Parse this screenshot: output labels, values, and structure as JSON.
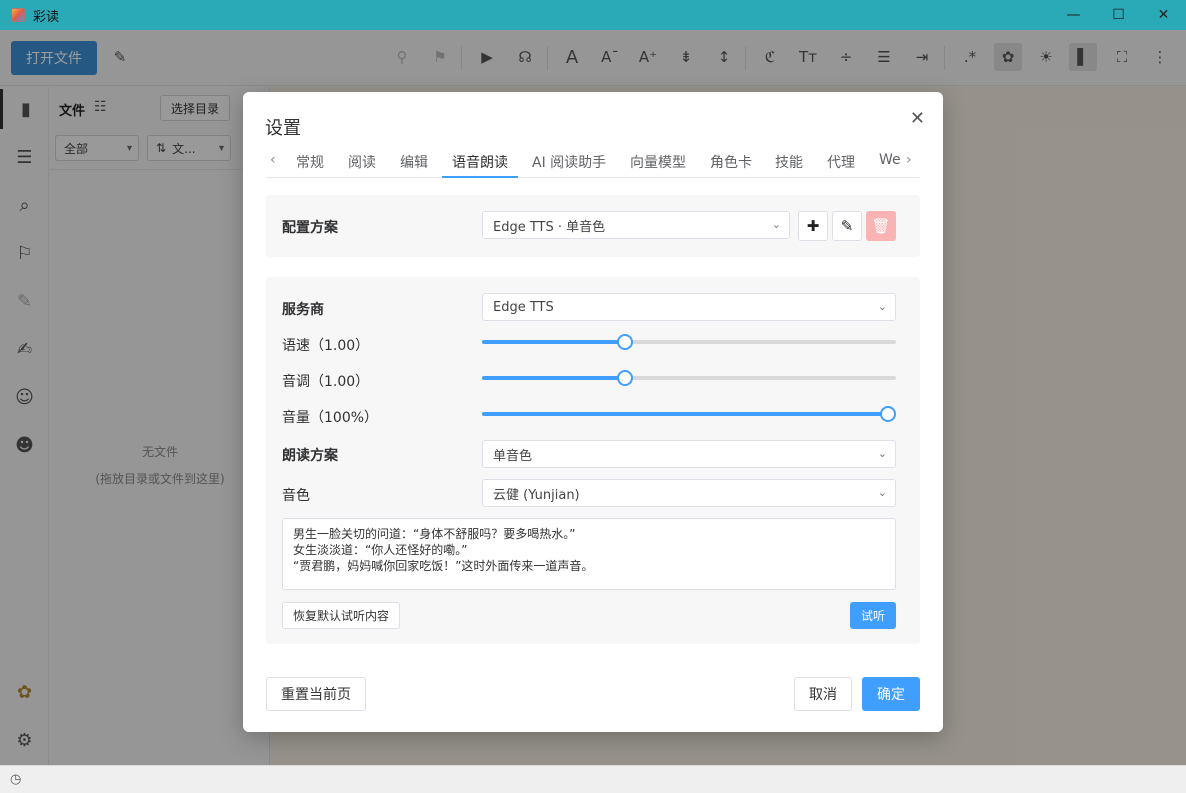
{
  "window": {
    "title": "彩读",
    "minimize_glyph": "—",
    "maximize_glyph": "☐",
    "close_glyph": "✕"
  },
  "toolbar": {
    "open_file_label": "打开文件",
    "icons": [
      "edit-icon",
      "pin-icon",
      "bookmark-icon",
      "play-icon",
      "headphones-icon",
      "font-icon",
      "font-decrease-icon",
      "font-increase-icon",
      "line-compress-icon",
      "line-expand-icon",
      "translate-icon",
      "text-size-icon",
      "paragraph-spacing-icon",
      "align-icon",
      "page-turn-icon",
      "regex-icon",
      "palette-icon",
      "brightness-icon",
      "sidebar-toggle-icon",
      "fullscreen-icon",
      "more-icon"
    ]
  },
  "rail": {
    "items": [
      "book-icon",
      "list-icon",
      "search-icon",
      "bookmark-icon",
      "pencil-icon",
      "note-icon",
      "ai-chat-icon",
      "emoji-icon",
      "palette-icon",
      "settings-icon"
    ]
  },
  "filepanel": {
    "title": "文件",
    "choose_dir_label": "选择目录",
    "filter_all": "全部",
    "sort_label": "文...",
    "empty_title": "无文件",
    "empty_hint": "(拖放目录或文件到这里)"
  },
  "dialog": {
    "title": "设置",
    "tabs": [
      "常规",
      "阅读",
      "编辑",
      "语音朗读",
      "AI 阅读助手",
      "向量模型",
      "角色卡",
      "技能",
      "代理",
      "We"
    ],
    "active_tab": "语音朗读",
    "profile": {
      "label": "配置方案",
      "value": "Edge TTS · 单音色"
    },
    "provider": {
      "label": "服务商",
      "value": "Edge TTS"
    },
    "rate": {
      "label": "语速（1.00）",
      "value": 1.0,
      "fraction": 0.34
    },
    "pitch": {
      "label": "音调（1.00）",
      "value": 1.0,
      "fraction": 0.34
    },
    "volume": {
      "label": "音量（100%）",
      "value": 100,
      "fraction": 1.0
    },
    "reading_scheme": {
      "label": "朗读方案",
      "value": "单音色"
    },
    "voice": {
      "label": "音色",
      "value": "云健 (Yunjian)"
    },
    "sample_text": {
      "line1": "男生一脸关切的问道：“身体不舒服吗？要多喝热水。”",
      "line2": "女生淡淡道：“你人还怪好的嘞。”",
      "line3": "“贾君鹏，妈妈喊你回家吃饭！”这时外面传来一道声音。"
    },
    "restore_label": "恢复默认试听内容",
    "listen_label": "试听",
    "reset_label": "重置当前页",
    "cancel_label": "取消",
    "ok_label": "确定"
  },
  "colors": {
    "titlebar": "#2aa9b7",
    "accent": "#409eff",
    "open_button": "#3d8ed4",
    "delete_disabled": "#f9b3b3"
  }
}
